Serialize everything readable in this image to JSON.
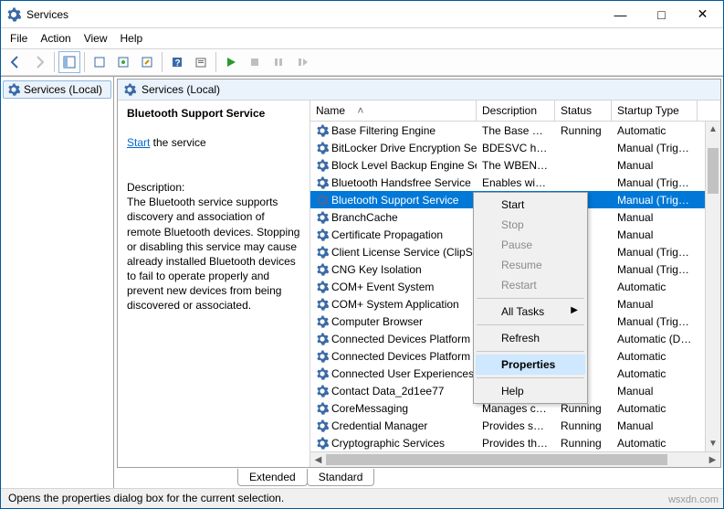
{
  "title": "Services",
  "menu": {
    "file": "File",
    "action": "Action",
    "view": "View",
    "help": "Help"
  },
  "nav": {
    "services_local": "Services (Local)"
  },
  "detail": {
    "title": "Bluetooth Support Service",
    "start_link": "Start",
    "start_suffix": " the service",
    "desc_label": "Description:",
    "desc_text": "The Bluetooth service supports discovery and association of remote Bluetooth devices.  Stopping or disabling this service may cause already installed Bluetooth devices to fail to operate properly and prevent new devices from being discovered or associated."
  },
  "columns": {
    "name": "Name",
    "description": "Description",
    "status": "Status",
    "startup": "Startup Type"
  },
  "rows": [
    {
      "name": "Base Filtering Engine",
      "desc": "The Base Fil…",
      "status": "Running",
      "startup": "Automatic"
    },
    {
      "name": "BitLocker Drive Encryption Se…",
      "desc": "BDESVC hos…",
      "status": "",
      "startup": "Manual (Trig…"
    },
    {
      "name": "Block Level Backup Engine Se…",
      "desc": "The WBENG…",
      "status": "",
      "startup": "Manual"
    },
    {
      "name": "Bluetooth Handsfree Service",
      "desc": "Enables wir…",
      "status": "",
      "startup": "Manual (Trig…"
    },
    {
      "name": "Bluetooth Support Service",
      "desc": "",
      "status": "",
      "startup": "Manual (Trig…",
      "selected": true
    },
    {
      "name": "BranchCache",
      "desc": "",
      "status": "",
      "startup": "Manual"
    },
    {
      "name": "Certificate Propagation",
      "desc": "",
      "status": "g",
      "startup": "Manual"
    },
    {
      "name": "Client License Service (ClipSV",
      "desc": "",
      "status": "",
      "startup": "Manual (Trig…"
    },
    {
      "name": "CNG Key Isolation",
      "desc": "",
      "status": "g",
      "startup": "Manual (Trig…"
    },
    {
      "name": "COM+ Event System",
      "desc": "",
      "status": "g",
      "startup": "Automatic"
    },
    {
      "name": "COM+ System Application",
      "desc": "",
      "status": "",
      "startup": "Manual"
    },
    {
      "name": "Computer Browser",
      "desc": "",
      "status": "",
      "startup": "Manual (Trig…"
    },
    {
      "name": "Connected Devices Platform",
      "desc": "",
      "status": "g",
      "startup": "Automatic (D…"
    },
    {
      "name": "Connected Devices Platform",
      "desc": "",
      "status": "g",
      "startup": "Automatic"
    },
    {
      "name": "Connected User Experiences",
      "desc": "",
      "status": "g",
      "startup": "Automatic"
    },
    {
      "name": "Contact Data_2d1ee77",
      "desc": "",
      "status": "g",
      "startup": "Manual"
    },
    {
      "name": "CoreMessaging",
      "desc": "Manages co…",
      "status": "Running",
      "startup": "Automatic"
    },
    {
      "name": "Credential Manager",
      "desc": "Provides se…",
      "status": "Running",
      "startup": "Manual"
    },
    {
      "name": "Cryptographic Services",
      "desc": "Provides thr…",
      "status": "Running",
      "startup": "Automatic"
    }
  ],
  "ctx": {
    "start": "Start",
    "stop": "Stop",
    "pause": "Pause",
    "resume": "Resume",
    "restart": "Restart",
    "all_tasks": "All Tasks",
    "refresh": "Refresh",
    "properties": "Properties",
    "help": "Help"
  },
  "tabs": {
    "extended": "Extended",
    "standard": "Standard"
  },
  "statusbar": "Opens the properties dialog box for the current selection.",
  "watermark": "wsxdn.com"
}
